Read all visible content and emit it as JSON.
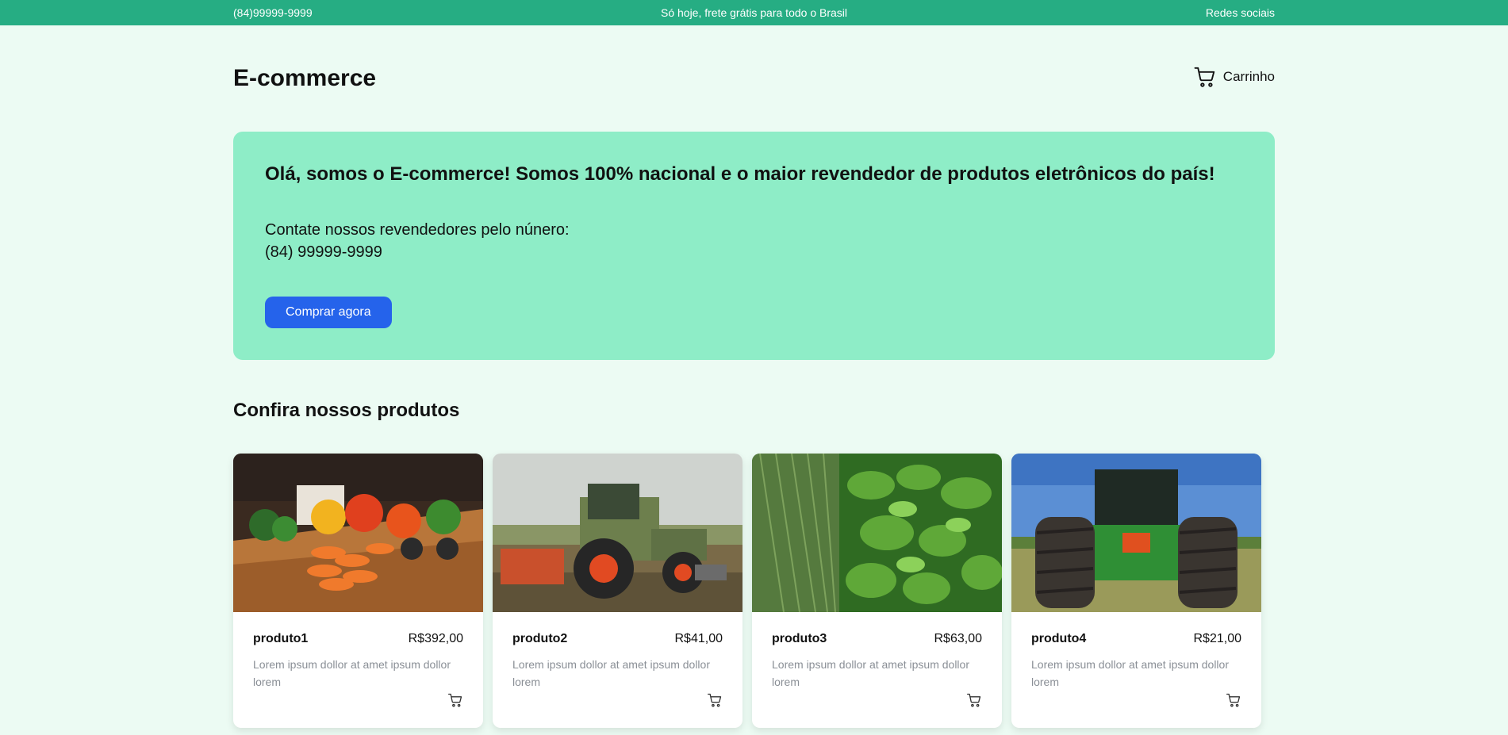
{
  "topbar": {
    "phone": "(84)99999-9999",
    "promo": "Só hoje, frete grátis para todo o Brasil",
    "social": "Redes sociais"
  },
  "header": {
    "logo": "E-commerce",
    "cart_label": "Carrinho",
    "cart_icon": "cart-icon"
  },
  "hero": {
    "title": "Olá, somos o E-commerce! Somos 100% nacional e o maior revendedor de produtos eletrônicos do país!",
    "contact_line": "Contate nossos revendedores pelo núnero:",
    "contact_phone": "(84) 99999-9999",
    "cta": "Comprar agora"
  },
  "products_section": {
    "title": "Confira nossos produtos"
  },
  "products": [
    {
      "name": "produto1",
      "price": "R$392,00",
      "description": "Lorem ipsum dollor at amet ipsum dollor lorem",
      "image": "vegetable-tractor-photo"
    },
    {
      "name": "produto2",
      "price": "R$41,00",
      "description": "Lorem ipsum dollor at amet ipsum dollor lorem",
      "image": "tractor-field-photo"
    },
    {
      "name": "produto3",
      "price": "R$63,00",
      "description": "Lorem ipsum dollor at amet ipsum dollor lorem",
      "image": "leafy-greens-photo"
    },
    {
      "name": "produto4",
      "price": "R$21,00",
      "description": "Lorem ipsum dollor at amet ipsum dollor lorem",
      "image": "tractor-rear-photo"
    }
  ],
  "colors": {
    "topbar": "#26ad83",
    "page_bg": "#ecfbf3",
    "hero_bg": "#8eedc7",
    "button": "#2563eb"
  }
}
